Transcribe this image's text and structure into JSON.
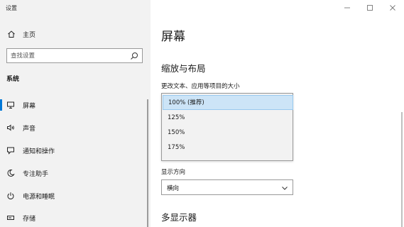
{
  "window": {
    "title": "设置",
    "controls": {
      "minimize": "minimize",
      "maximize": "maximize",
      "close": "close"
    }
  },
  "sidebar": {
    "home_label": "主页",
    "search_placeholder": "查找设置",
    "section_label": "系统",
    "items": [
      {
        "label": "屏幕",
        "icon": "monitor-icon",
        "active": true
      },
      {
        "label": "声音",
        "icon": "speaker-icon",
        "active": false
      },
      {
        "label": "通知和操作",
        "icon": "notification-icon",
        "active": false
      },
      {
        "label": "专注助手",
        "icon": "moon-icon",
        "active": false
      },
      {
        "label": "电源和睡眠",
        "icon": "power-icon",
        "active": false
      },
      {
        "label": "存储",
        "icon": "storage-icon",
        "active": false
      }
    ]
  },
  "main": {
    "title": "屏幕",
    "scale_layout_heading": "缩放与布局",
    "scale_label": "更改文本、应用等项目的大小",
    "scale_options": [
      "100% (推荐)",
      "125%",
      "150%",
      "175%"
    ],
    "scale_selected": "100% (推荐)",
    "orientation_label": "显示方向",
    "orientation_value": "横向",
    "multi_display_heading": "多显示器"
  },
  "colors": {
    "accent": "#0078d7",
    "sidebar_bg": "#f2f2f2",
    "selected_bg": "#cce4f7"
  }
}
